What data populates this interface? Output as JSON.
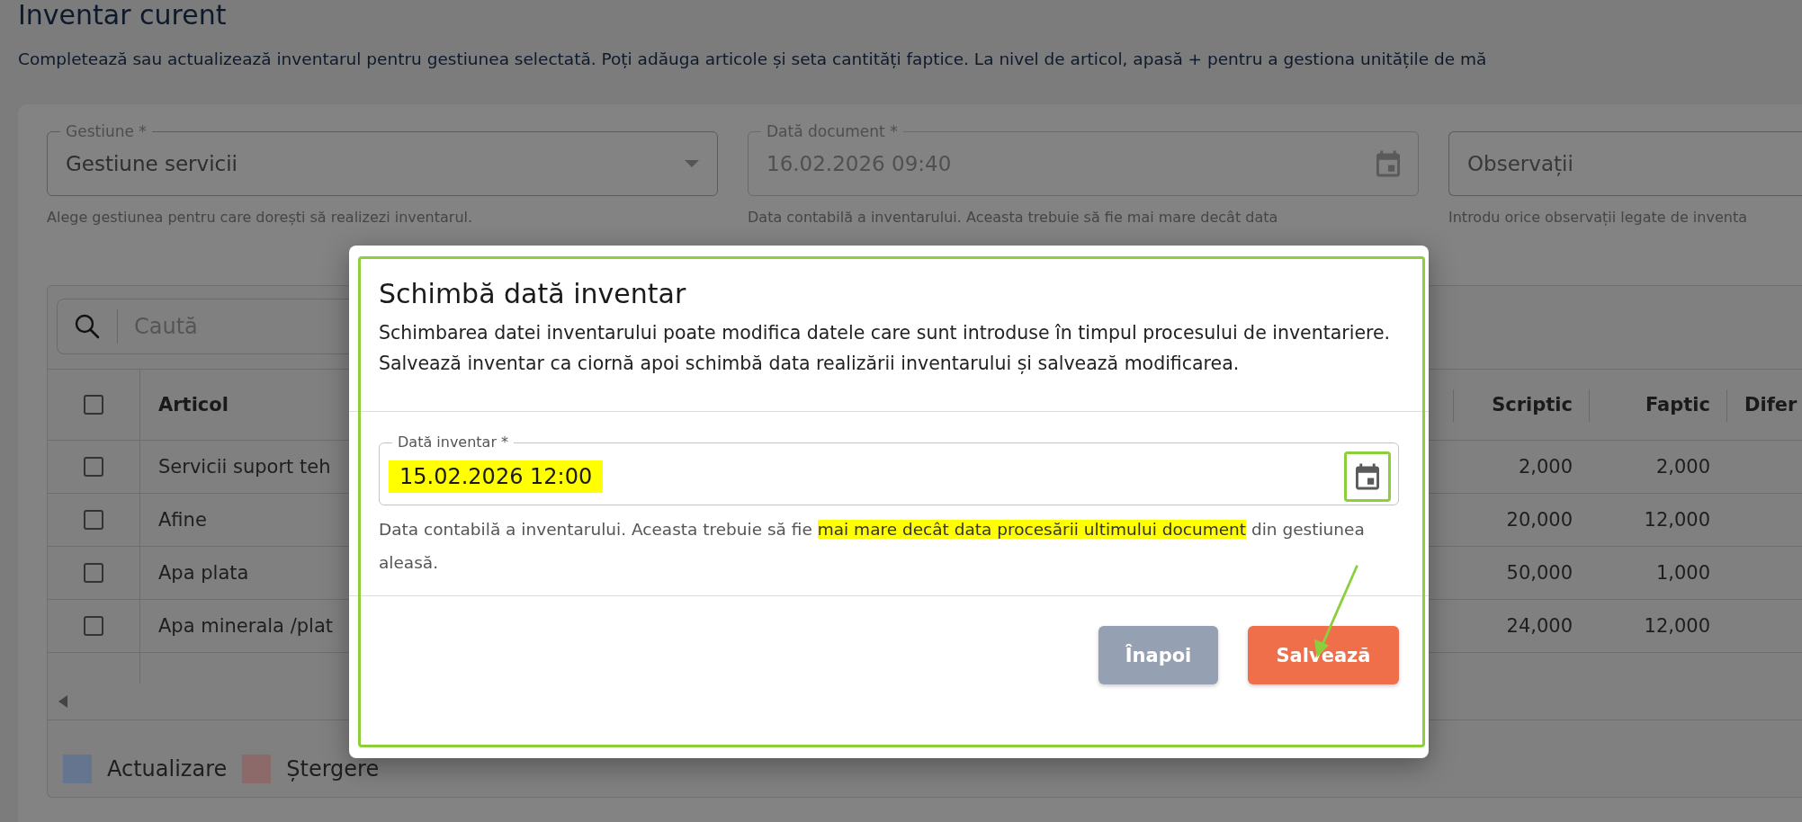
{
  "page": {
    "title": "Inventar curent",
    "description": "Completează sau actualizează inventarul pentru gestiunea selectată. Poți adăuga articole și seta cantități faptice. La nivel de articol, apasă + pentru a gestiona unitățile de mă"
  },
  "form": {
    "fields": [
      {
        "kind": "select",
        "label": "Gestiune *",
        "value": "Gestiune servicii",
        "disabled": false,
        "helper": "Alege gestiunea pentru care dorești să realizezi inventarul."
      },
      {
        "kind": "date",
        "label": "Dată document *",
        "value": "16.02.2026 09:40",
        "disabled": true,
        "helper": "Data contabilă a inventarului. Aceasta trebuie să fie mai mare decât data"
      },
      {
        "kind": "text",
        "placeholder": "Observații",
        "helper": "Introdu orice observații legate de inventa"
      }
    ]
  },
  "table": {
    "search": {
      "placeholder": "Caută"
    },
    "header_checked": false,
    "columns": [
      {
        "label": "Articol"
      },
      {
        "label": "Scriptic"
      },
      {
        "label": "Faptic"
      },
      {
        "label": "Difer"
      }
    ],
    "rows": [
      {
        "checked": false,
        "cells": [
          "Servicii suport teh",
          "2,000",
          "2,000"
        ]
      },
      {
        "checked": false,
        "cells": [
          "Afine",
          "20,000",
          "12,000"
        ]
      },
      {
        "checked": false,
        "cells": [
          "Apa plata",
          "50,000",
          "1,000"
        ]
      },
      {
        "checked": false,
        "cells": [
          "Apa minerala /plat",
          "24,000",
          "12,000"
        ]
      }
    ],
    "legend": [
      {
        "label": "Actualizare",
        "color": "#66758f"
      },
      {
        "label": "Ștergere",
        "color": "#8c6a6a"
      }
    ]
  },
  "dialog": {
    "title": "Schimbă dată inventar",
    "description": "Schimbarea datei inventarului poate modifica datele care sunt introduse în timpul procesului de inventariere. Salvează inventar ca ciornă apoi schimbă data realizării inventarului și salvează modificarea.",
    "field": {
      "label": "Dată inventar *",
      "value": "15.02.2026 12:00",
      "highlighted": true,
      "calendar_highlighted": true,
      "helper_parts": [
        {
          "text": "Data contabilă a inventarului. Aceasta trebuie să fie ",
          "highlighted": false
        },
        {
          "text": "mai mare decât data procesării ultimului document",
          "highlighted": true
        },
        {
          "text": " din gestiunea aleasă.",
          "highlighted": false
        }
      ]
    },
    "buttons": [
      {
        "label": "Înapoi",
        "kind": "secondary"
      },
      {
        "label": "Salvează",
        "kind": "primary"
      }
    ]
  }
}
